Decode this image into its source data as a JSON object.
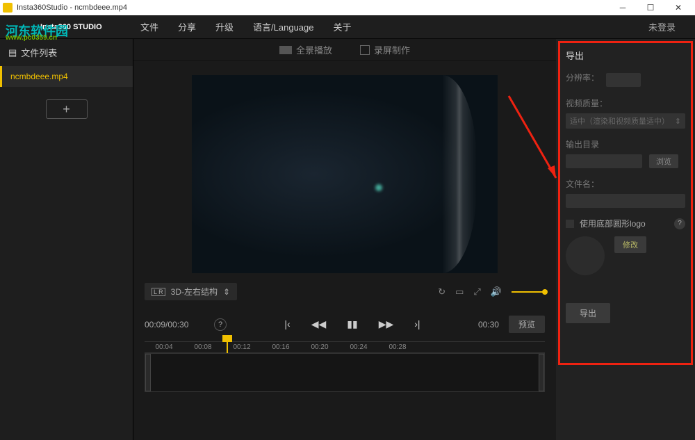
{
  "window": {
    "title": "Insta360Studio - ncmbdeee.mp4"
  },
  "watermark": {
    "main": "河东软件园",
    "sub": "www.pc0359.cn"
  },
  "logo": "Insta360 STUDIO",
  "menu": {
    "file": "文件",
    "share": "分享",
    "upgrade": "升级",
    "language": "语言/Language",
    "about": "关于"
  },
  "login_status": "未登录",
  "sidebar": {
    "header": "文件列表",
    "items": [
      {
        "name": "ncmbdeee.mp4"
      }
    ],
    "add": "+"
  },
  "tabs": {
    "pano": "全景播放",
    "record": "录屏制作"
  },
  "view": {
    "mode": "3D-左右结构",
    "chevron": "‹›",
    "lr": "L R"
  },
  "transport": {
    "current": "00:09",
    "sep": "/",
    "duration_a": "00:30",
    "help": "?",
    "goto_start": "|‹",
    "prev": "◀◀",
    "pause": "▮▮",
    "next": "▶▶",
    "goto_end": "›|",
    "duration_b": "00:30",
    "preview": "预览"
  },
  "timeline": {
    "ticks": [
      "00:04",
      "00:08",
      "00:12",
      "00:16",
      "00:20",
      "00:24",
      "00:28"
    ]
  },
  "export": {
    "title": "导出",
    "resolution_label": "分辨率：",
    "quality_label": "视频质量：",
    "quality_value": "适中（渲染和视频质量适中）",
    "output_dir_label": "输出目录",
    "browse": "浏览",
    "filename_label": "文件名：",
    "logo_label": "使用底部圆形logo",
    "help": "?",
    "modify": "修改",
    "export_btn": "导出"
  }
}
